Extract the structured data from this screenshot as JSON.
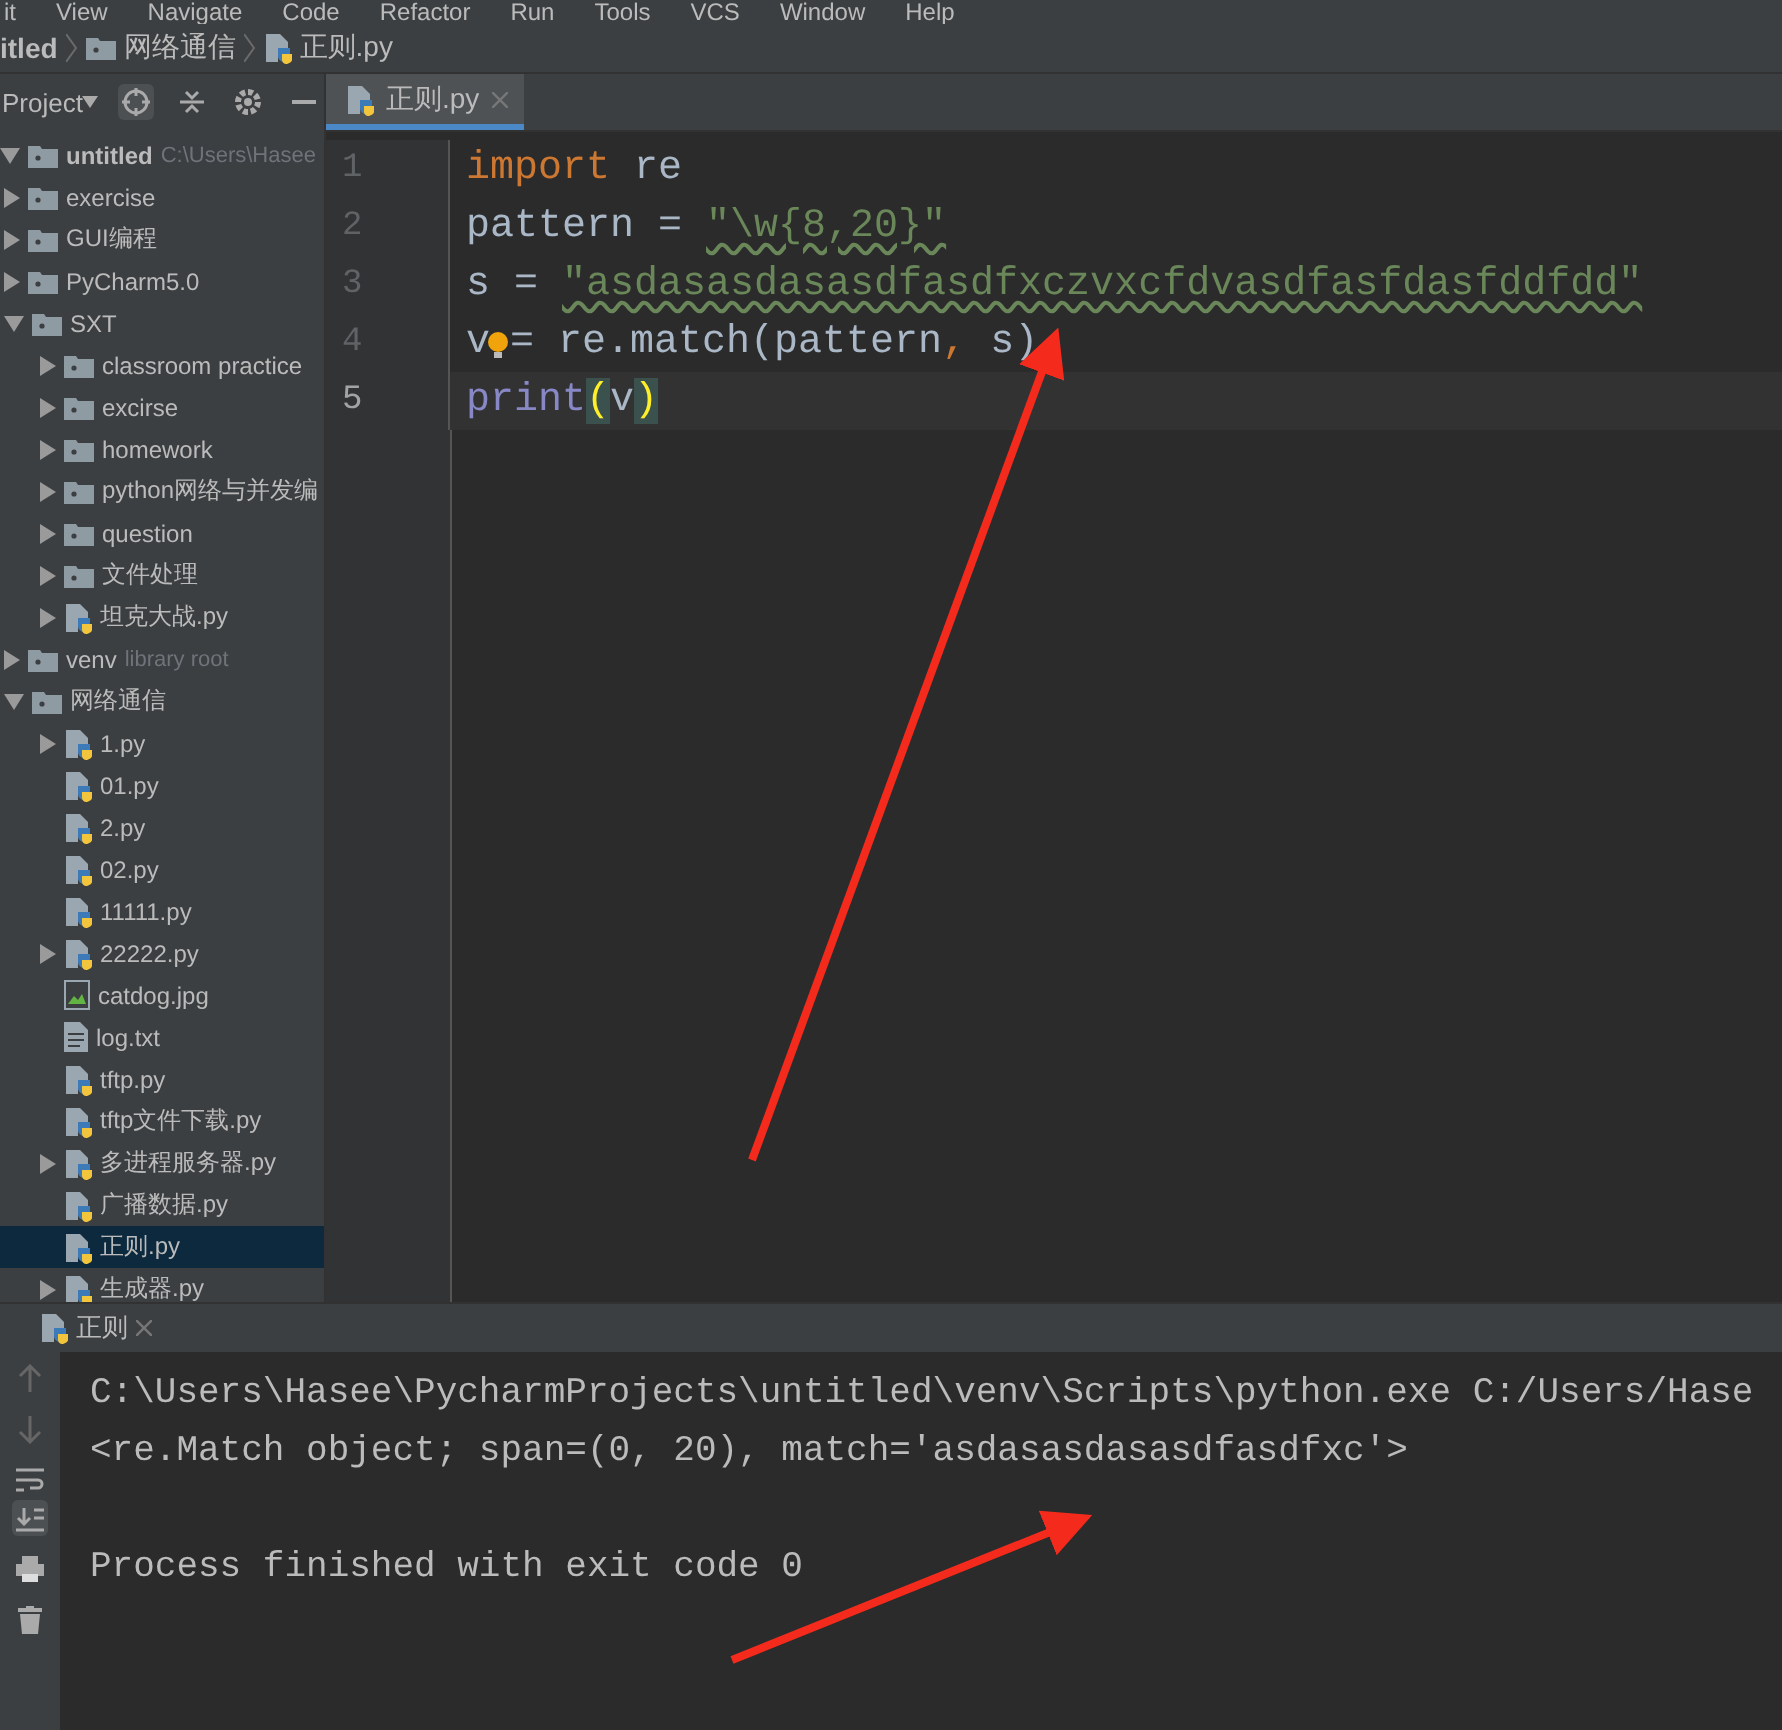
{
  "menu_bar": [
    "it",
    "View",
    "Navigate",
    "Code",
    "Refactor",
    "Run",
    "Tools",
    "VCS",
    "Window",
    "Help"
  ],
  "breadcrumb": [
    {
      "label": "itled",
      "kind": "project"
    },
    {
      "label": "网络通信",
      "kind": "folder"
    },
    {
      "label": "正则.py",
      "kind": "python"
    }
  ],
  "project_panel": {
    "title": "Project",
    "tree": [
      {
        "label": "untitled",
        "hint": "C:\\Users\\Hasee",
        "kind": "folder",
        "expandable": true,
        "expanded": true,
        "selected": false,
        "children": [
          {
            "label": "exercise",
            "kind": "folder",
            "expandable": true,
            "expanded": false,
            "selected": false
          },
          {
            "label": "GUI编程",
            "kind": "folder",
            "expandable": true,
            "expanded": false,
            "selected": false
          },
          {
            "label": "PyCharm5.0",
            "kind": "folder",
            "expandable": true,
            "expanded": false,
            "selected": false
          },
          {
            "label": "SXT",
            "kind": "folder",
            "expandable": true,
            "expanded": true,
            "selected": false,
            "children": [
              {
                "label": "classroom practice",
                "kind": "folder",
                "expandable": true,
                "expanded": false,
                "selected": false
              },
              {
                "label": "excirse",
                "kind": "folder",
                "expandable": true,
                "expanded": false,
                "selected": false
              },
              {
                "label": "homework",
                "kind": "folder",
                "expandable": true,
                "expanded": false,
                "selected": false
              },
              {
                "label": "python网络与并发编",
                "kind": "folder",
                "expandable": true,
                "expanded": false,
                "selected": false
              },
              {
                "label": "question",
                "kind": "folder",
                "expandable": true,
                "expanded": false,
                "selected": false
              },
              {
                "label": "文件处理",
                "kind": "folder",
                "expandable": true,
                "expanded": false,
                "selected": false
              },
              {
                "label": "坦克大战.py",
                "kind": "python",
                "expandable": true,
                "expanded": false,
                "selected": false
              }
            ]
          },
          {
            "label": "venv",
            "hint": "library root",
            "kind": "folder",
            "expandable": true,
            "expanded": false,
            "selected": false
          },
          {
            "label": "网络通信",
            "kind": "folder",
            "expandable": true,
            "expanded": true,
            "selected": false,
            "children": [
              {
                "label": "1.py",
                "kind": "python",
                "expandable": true,
                "expanded": false,
                "selected": false
              },
              {
                "label": "01.py",
                "kind": "python",
                "expandable": false,
                "selected": false
              },
              {
                "label": "2.py",
                "kind": "python",
                "expandable": false,
                "selected": false
              },
              {
                "label": "02.py",
                "kind": "python",
                "expandable": false,
                "selected": false
              },
              {
                "label": "11111.py",
                "kind": "python",
                "expandable": false,
                "selected": false
              },
              {
                "label": "22222.py",
                "kind": "python",
                "expandable": true,
                "expanded": false,
                "selected": false
              },
              {
                "label": "catdog.jpg",
                "kind": "image",
                "expandable": false,
                "selected": false
              },
              {
                "label": "log.txt",
                "kind": "text",
                "expandable": false,
                "selected": false
              },
              {
                "label": "tftp.py",
                "kind": "python",
                "expandable": false,
                "selected": false
              },
              {
                "label": "tftp文件下载.py",
                "kind": "python",
                "expandable": false,
                "selected": false
              },
              {
                "label": "多进程服务器.py",
                "kind": "python",
                "expandable": true,
                "expanded": false,
                "selected": false
              },
              {
                "label": "广播数据.py",
                "kind": "python",
                "expandable": false,
                "selected": false
              },
              {
                "label": "正则.py",
                "kind": "python",
                "expandable": false,
                "selected": true
              },
              {
                "label": "生成器.py",
                "kind": "python",
                "expandable": true,
                "expanded": false,
                "selected": false
              }
            ]
          }
        ]
      }
    ]
  },
  "editor": {
    "tabs": [
      {
        "label": "正则.py",
        "selected": true
      }
    ],
    "lines": [
      {
        "number": "1",
        "current": false,
        "tokens": [
          {
            "kind": "keyword",
            "text": "import"
          },
          {
            "kind": "plain",
            "text": " re"
          }
        ]
      },
      {
        "number": "2",
        "current": false,
        "tokens": [
          {
            "kind": "plain",
            "text": "pattern = "
          },
          {
            "kind": "string",
            "text": "\"\\w{8,20}\""
          }
        ]
      },
      {
        "number": "3",
        "current": false,
        "tokens": [
          {
            "kind": "plain",
            "text": "s = "
          },
          {
            "kind": "string",
            "text": "\"asdasasdasasdfasdfxczvxcfdvasdfasfdasfddfdd\""
          }
        ]
      },
      {
        "number": "4",
        "current": false,
        "tokens": [
          {
            "kind": "plain",
            "text": "v"
          },
          {
            "kind": "bulb"
          },
          {
            "kind": "plain",
            "text": "= re.match(pattern"
          },
          {
            "kind": "keyword",
            "text": ","
          },
          {
            "kind": "plain",
            "text": " s)"
          }
        ]
      },
      {
        "number": "5",
        "current": true,
        "tokens": [
          {
            "kind": "builtin",
            "text": "print"
          },
          {
            "kind": "brace",
            "text": "("
          },
          {
            "kind": "plain",
            "text": "v"
          },
          {
            "kind": "brace",
            "text": ")"
          }
        ]
      }
    ]
  },
  "run_panel": {
    "tab": "正则",
    "output_blocks": [
      [
        "C:\\Users\\Hasee\\PycharmProjects\\untitled\\venv\\Scripts\\python.exe C:/Users/Hase",
        "<re.Match object; span=(0, 20), match='asdasasdasasdfasdfxc'>"
      ],
      [
        "Process finished with exit code 0"
      ]
    ]
  }
}
